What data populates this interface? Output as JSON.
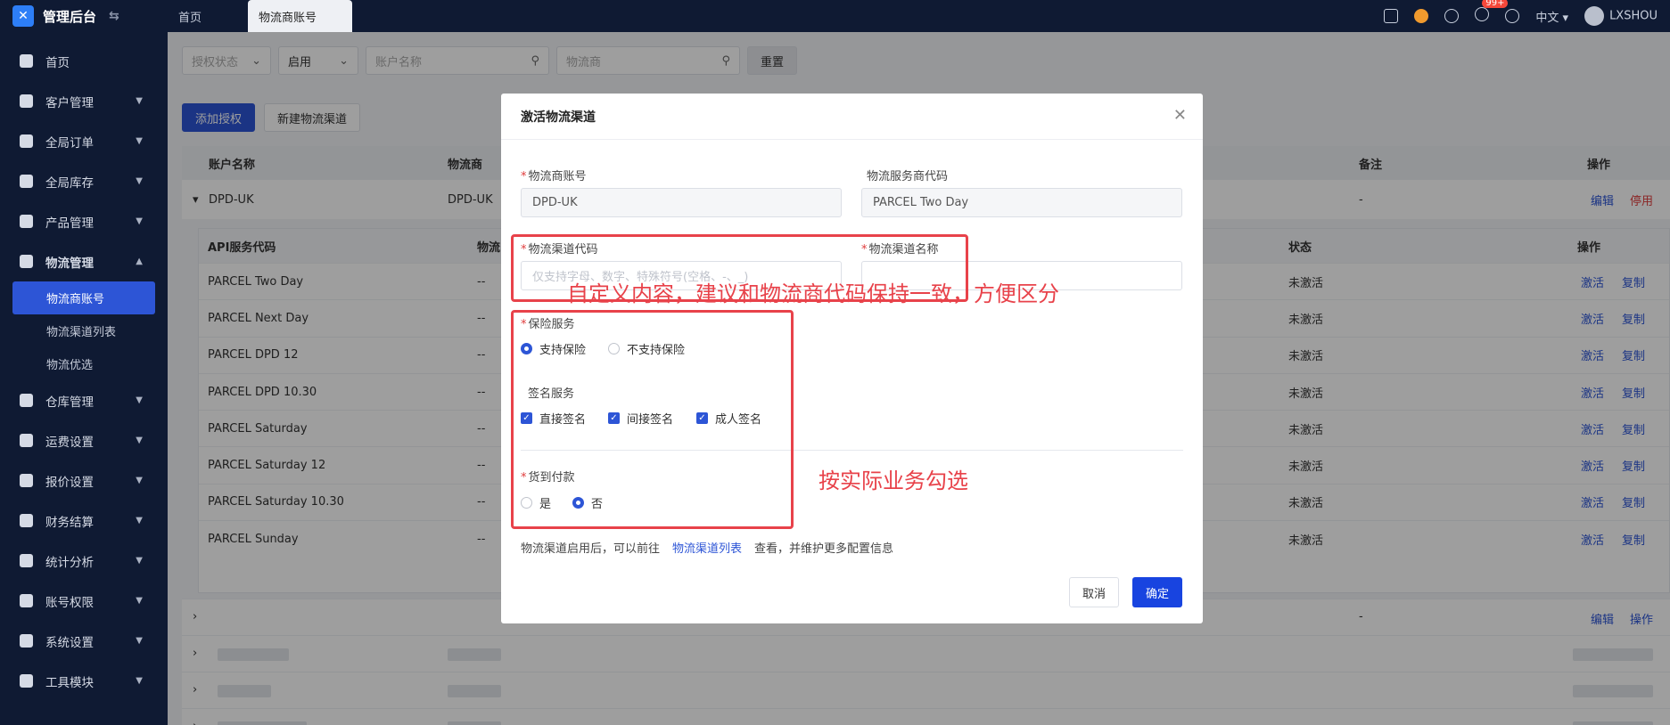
{
  "topbar": {
    "app_title": "管理后台",
    "tabs": [
      {
        "label": "首页"
      },
      {
        "label": "物流商账号"
      }
    ],
    "badge": "99+",
    "language": "中文",
    "username": "LXSHOU"
  },
  "sidebar": {
    "items": [
      {
        "label": "首页"
      },
      {
        "label": "客户管理"
      },
      {
        "label": "全局订单"
      },
      {
        "label": "全局库存"
      },
      {
        "label": "产品管理"
      },
      {
        "label": "物流管理"
      },
      {
        "label": "仓库管理"
      },
      {
        "label": "运费设置"
      },
      {
        "label": "报价设置"
      },
      {
        "label": "财务结算"
      },
      {
        "label": "统计分析"
      },
      {
        "label": "账号权限"
      },
      {
        "label": "系统设置"
      },
      {
        "label": "工具模块"
      }
    ],
    "subitems": [
      {
        "label": "物流商账号"
      },
      {
        "label": "物流渠道列表"
      },
      {
        "label": "物流优选"
      }
    ]
  },
  "filters": {
    "auth_status_placeholder": "授权状态",
    "status_value": "启用",
    "account_placeholder": "账户名称",
    "carrier_placeholder": "物流商",
    "reset_label": "重置"
  },
  "actions": {
    "add_auth_label": "添加授权",
    "new_channel_label": "新建物流渠道"
  },
  "table": {
    "headers": [
      "账户名称",
      "物流商",
      "备注",
      "操作"
    ],
    "row": {
      "account": "DPD-UK",
      "carrier": "DPD-UK",
      "remark": "-",
      "edit": "编辑",
      "disable": "停用"
    },
    "sub_headers": [
      "API服务代码",
      "物流",
      "状态",
      "操作"
    ],
    "sub_rows": [
      {
        "code": "PARCEL Two Day",
        "col2": "--",
        "status": "未激活"
      },
      {
        "code": "PARCEL Next Day",
        "col2": "--",
        "status": "未激活"
      },
      {
        "code": "PARCEL DPD 12",
        "col2": "--",
        "status": "未激活"
      },
      {
        "code": "PARCEL DPD 10.30",
        "col2": "--",
        "status": "未激活"
      },
      {
        "code": "PARCEL Saturday",
        "col2": "--",
        "status": "未激活"
      },
      {
        "code": "PARCEL Saturday 12",
        "col2": "--",
        "status": "未激活"
      },
      {
        "code": "PARCEL Saturday 10.30",
        "col2": "--",
        "status": "未激活"
      },
      {
        "code": "PARCEL Sunday",
        "col2": "--",
        "status": "未激活"
      }
    ],
    "activate_label": "激活",
    "copy_label": "复制",
    "lower_remark": "-",
    "lower_edit": "编辑",
    "lower_ops": "操作"
  },
  "modal": {
    "title": "激活物流渠道",
    "carrier_account_label": "物流商账号",
    "carrier_account_value": "DPD-UK",
    "service_code_label": "物流服务商代码",
    "service_code_value": "PARCEL Two Day",
    "channel_code_label": "物流渠道代码",
    "channel_code_placeholder": "仅支持字母、数字、特殊符号(空格、-、_)",
    "channel_name_label": "物流渠道名称",
    "insurance_label": "保险服务",
    "insurance_options": [
      "支持保险",
      "不支持保险"
    ],
    "insurance_selected": "支持保险",
    "signature_label": "签名服务",
    "signature_options": [
      "直接签名",
      "间接签名",
      "成人签名"
    ],
    "cod_label": "货到付款",
    "cod_options": [
      "是",
      "否"
    ],
    "cod_selected": "否",
    "note_prefix": "物流渠道启用后，可以前往",
    "note_link": "物流渠道列表",
    "note_suffix": "查看，并维护更多配置信息",
    "cancel_label": "取消",
    "confirm_label": "确定"
  },
  "annotations": {
    "top": "自定义内容，建议和物流商代码保持一致，方便区分",
    "bottom": "按实际业务勾选",
    "color": "#e8424a"
  },
  "colors": {
    "primary": "#2d55d6",
    "sidebar_bg": "#0f1a33",
    "danger": "#e03c3c"
  }
}
